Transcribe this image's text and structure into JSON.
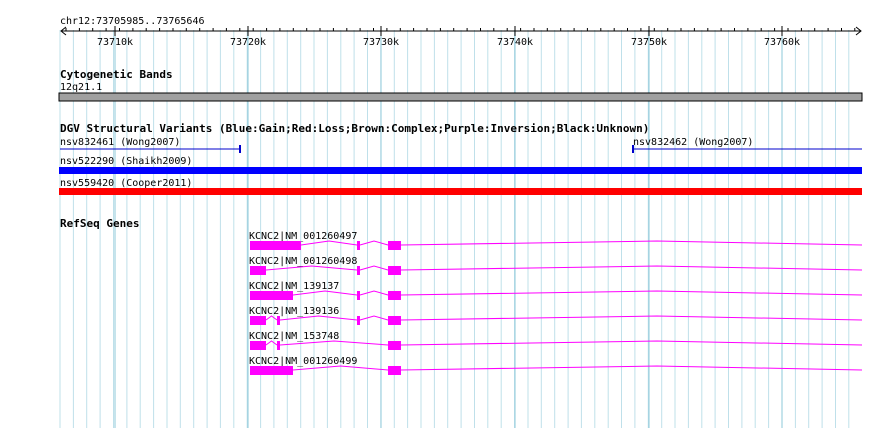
{
  "region_label": "chr12:73705985..73765646",
  "ruler_ticks": [
    "73710k",
    "73720k",
    "73730k",
    "73740k",
    "73750k",
    "73760k"
  ],
  "tracks": {
    "cytoband": {
      "title": "Cytogenetic Bands",
      "band": "12q21.1",
      "band_color": "#a0a0a0"
    },
    "dgv": {
      "title": "DGV Structural Variants (Blue:Gain;Red:Loss;Brown:Complex;Purple:Inversion;Black:Unknown)",
      "variants": [
        {
          "label": "nsv832461 (Wong2007)",
          "color": "#0000cc"
        },
        {
          "label": "nsv832462 (Wong2007)",
          "color": "#0000cc"
        },
        {
          "label": "nsv522290 (Shaikh2009)",
          "color": "#0000ff"
        },
        {
          "label": "nsv559420 (Cooper2011)",
          "color": "#ff0000"
        }
      ]
    },
    "refseq": {
      "title": "RefSeq Genes",
      "gene_color": "#ff00ff",
      "genes": [
        {
          "label": "KCNC2|NM_001260497"
        },
        {
          "label": "KCNC2|NM_001260498"
        },
        {
          "label": "KCNC2|NM_139137"
        },
        {
          "label": "KCNC2|NM_139136"
        },
        {
          "label": "KCNC2|NM_153748"
        },
        {
          "label": "KCNC2|NM_001260499"
        }
      ]
    }
  }
}
